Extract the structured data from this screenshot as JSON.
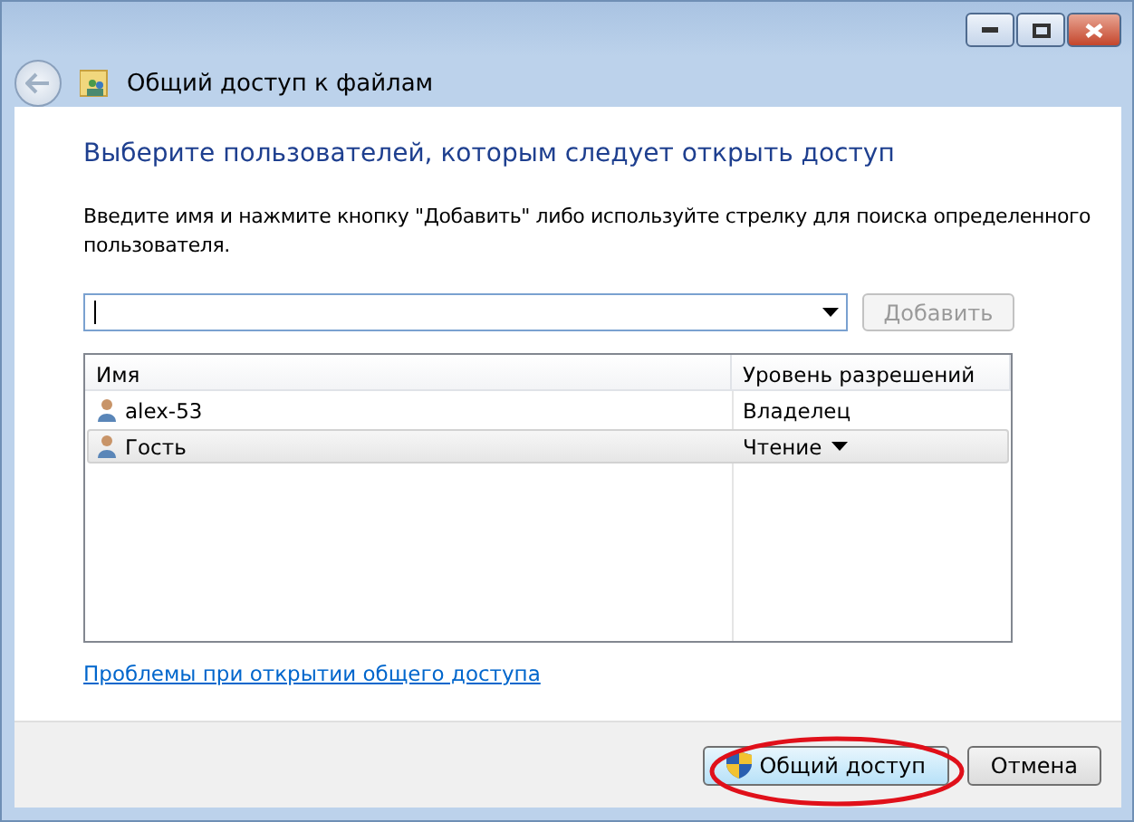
{
  "window": {
    "title": "Общий доступ к файлам"
  },
  "heading": "Выберите пользователей, которым следует открыть доступ",
  "instruction": "Введите имя и нажмите кнопку \"Добавить\" либо используйте стрелку для поиска определенного пользователя.",
  "add_button": {
    "label": "Добавить",
    "disabled": true
  },
  "table": {
    "columns": [
      "Имя",
      "Уровень разрешений"
    ],
    "rows": [
      {
        "name": "alex-53",
        "permission": "Владелец",
        "selected": false
      },
      {
        "name": "Гость",
        "permission": "Чтение",
        "selected": true
      }
    ]
  },
  "help_link": "Проблемы при открытии общего доступа",
  "buttons": [
    {
      "label": "Общий доступ",
      "kind": "primary"
    },
    {
      "label": "Отмена",
      "kind": "normal"
    }
  ]
}
